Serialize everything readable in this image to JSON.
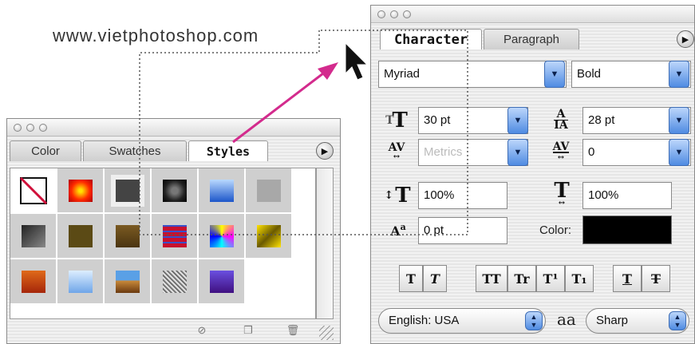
{
  "watermark": "www.vietphotoshop.com",
  "styles_panel": {
    "tabs": [
      "Color",
      "Swatches",
      "Styles"
    ],
    "active_tab": "Styles",
    "footer_icons": [
      "no-style-icon",
      "new-style-icon",
      "trash-icon"
    ]
  },
  "character_panel": {
    "tabs": [
      "Character",
      "Paragraph"
    ],
    "active_tab": "Character",
    "font_family": "Myriad",
    "font_style": "Bold",
    "font_size": "30 pt",
    "leading": "28 pt",
    "kerning": "Metrics",
    "tracking": "0",
    "vertical_scale": "100%",
    "horizontal_scale": "100%",
    "baseline_shift": "0 pt",
    "color_label": "Color:",
    "color_value": "#000000",
    "style_buttons": [
      "T",
      "T",
      "TT",
      "Tr",
      "T¹",
      "T₁",
      "T",
      "T"
    ],
    "language": "English: USA",
    "antialias_icon_text": "aa",
    "antialias": "Sharp"
  }
}
